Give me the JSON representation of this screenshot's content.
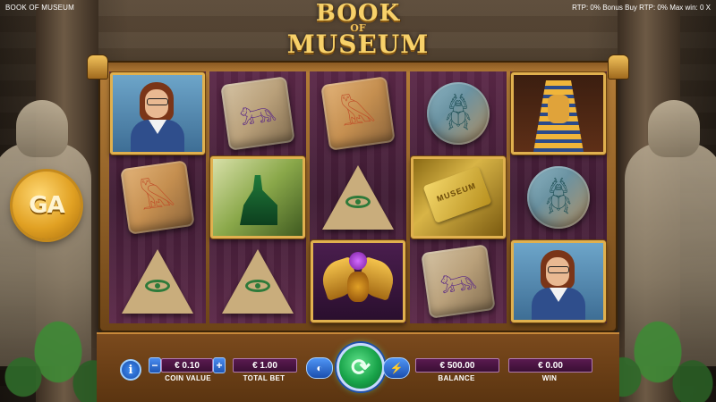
{
  "window": {
    "title": "BOOK OF MUSEUM",
    "rtp_text": "RTP: 0% Bonus Buy RTP: 0% Max win: 0 X"
  },
  "logo": {
    "line1": "BOOK",
    "line2": "OF",
    "line3": "MUSEUM"
  },
  "brand_badge": {
    "text": "GA"
  },
  "reels": [
    [
      "woman-portrait",
      "bird-stone",
      "eye-pyramid"
    ],
    [
      "sphinx-stone",
      "anubis-portrait",
      "eye-pyramid"
    ],
    [
      "bird-stone",
      "eye-pyramid",
      "scarab-wild"
    ],
    [
      "scarab-stone",
      "ticket-portrait",
      "sphinx-stone"
    ],
    [
      "pharaoh-portrait",
      "scarab-stone",
      "woman-portrait"
    ]
  ],
  "ticket_symbol_text": "MUSEUM",
  "controls": {
    "info_label": "i",
    "coin_value": "€ 0.10",
    "coin_value_label": "COIN VALUE",
    "minus": "−",
    "plus": "+",
    "total_bet": "€ 1.00",
    "total_bet_label": "TOTAL BET",
    "autoplay_icon": "autoplay-icon",
    "spin_icon": "spin-arrows-icon",
    "turbo_icon": "lightning-icon",
    "balance": "€ 500.00",
    "balance_label": "BALANCE",
    "win": "€ 0.00",
    "win_label": "WIN"
  },
  "colors": {
    "accent_gold": "#f7d16a",
    "spin_green": "#19a44a",
    "field_purple": "#3a0f34",
    "button_blue": "#1f56b4"
  }
}
